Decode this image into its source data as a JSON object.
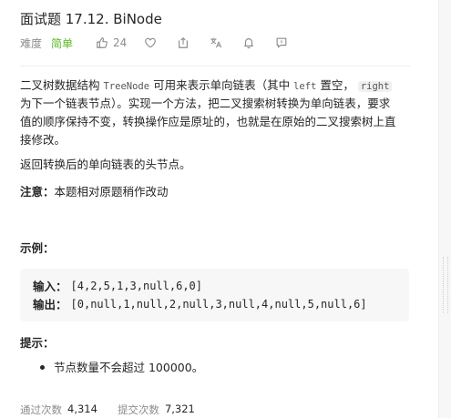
{
  "problem": {
    "title": "面试题 17.12. BiNode",
    "difficulty_label": "难度",
    "difficulty": "简单",
    "likes": "24"
  },
  "toolbar": {
    "icons": [
      "thumbs-up-icon",
      "heart-icon",
      "share-icon",
      "translate-icon",
      "bell-icon",
      "comment-icon"
    ]
  },
  "description": {
    "line1_a": "二叉树数据结构",
    "line1_code1": "TreeNode",
    "line1_b": "可用来表示单向链表（其中",
    "line1_code2": "left",
    "line1_c": "置空，",
    "line1_code3": "right",
    "line2": "为下一个链表节点）。实现一个方法，把二叉搜索树转换为单向链表，要求",
    "line3": "值的顺序保持不变，转换操作应是原址的，也就是在原始的二叉搜索树上直",
    "line4": "接修改。",
    "return_text": "返回转换后的单向链表的头节点。",
    "note_label": "注意：",
    "note_text": "本题相对原题稍作改动"
  },
  "example": {
    "heading": "示例：",
    "input_label": "输入：",
    "input_value": "[4,2,5,1,3,null,6,0]",
    "output_label": "输出：",
    "output_value": "[0,null,1,null,2,null,3,null,4,null,5,null,6]"
  },
  "hints": {
    "heading": "提示：",
    "items": [
      "节点数量不会超过 100000。"
    ]
  },
  "stats": {
    "accepted_label": "通过次数",
    "accepted_value": "4,314",
    "submissions_label": "提交次数",
    "submissions_value": "7,321"
  }
}
